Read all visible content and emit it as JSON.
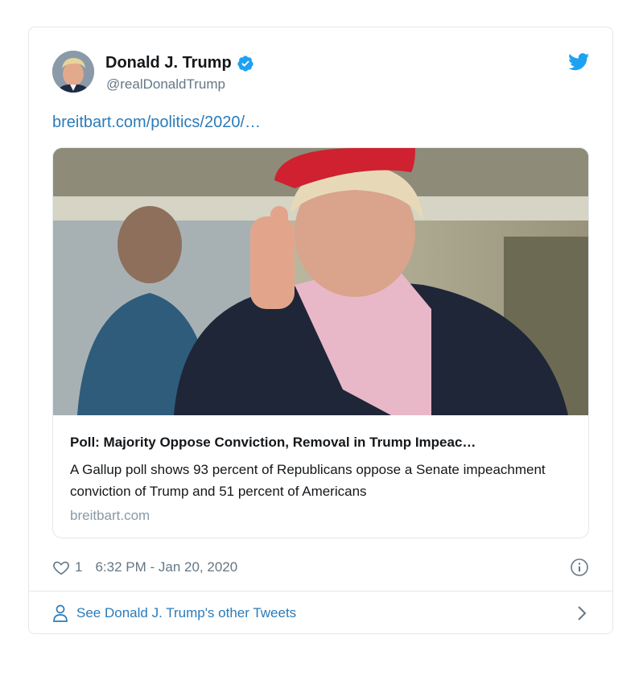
{
  "tweet": {
    "display_name": "Donald J. Trump",
    "handle": "@realDonaldTrump",
    "text_link": "breitbart.com/politics/2020/…",
    "verified": true
  },
  "link_card": {
    "title": "Poll: Majority Oppose Conviction, Removal in Trump Impeac…",
    "description": "A Gallup poll shows 93 percent of Republicans oppose a Senate impeachment conviction of Trump and 51 percent of Americans",
    "domain": "breitbart.com"
  },
  "meta": {
    "like_count": "1",
    "timestamp": "6:32 PM - Jan 20, 2020"
  },
  "footer": {
    "other_tweets_label": "See Donald J. Trump's other Tweets"
  },
  "icons": {
    "verified": "verified-badge-icon",
    "twitter": "twitter-bird-icon",
    "like": "heart-icon",
    "info": "info-icon",
    "profile": "person-icon",
    "next": "chevron-right-icon"
  },
  "colors": {
    "brand_blue": "#1da1f2",
    "link_blue": "#2b7bb9",
    "secondary_text": "#657786",
    "border": "#e1e8ed"
  }
}
